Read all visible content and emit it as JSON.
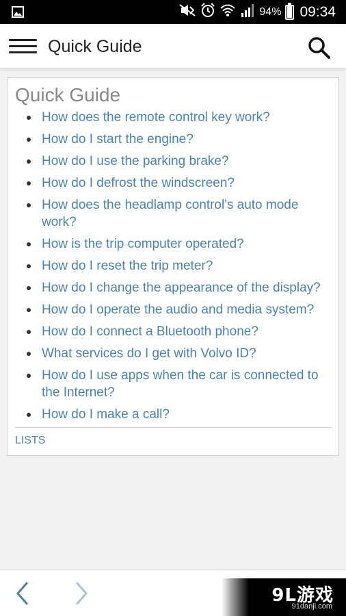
{
  "status_bar": {
    "battery_percent": "94%",
    "battery_level": 0.94,
    "time": "09:34",
    "icons": [
      "image-icon",
      "mute-icon",
      "alarm-icon",
      "wifi-icon",
      "signal-icon",
      "battery-icon"
    ]
  },
  "app_bar": {
    "title": "Quick Guide"
  },
  "card": {
    "title": "Quick Guide",
    "items": [
      "How does the remote control key work?",
      "How do I start the engine?",
      "How do I use the parking brake?",
      "How do I defrost the windscreen?",
      "How does the headlamp control's auto mode work?",
      "How is the trip computer operated?",
      "How do I reset the trip meter?",
      "How do I change the appearance of the display?",
      "How do I operate the audio and media system?",
      "How do I connect a Bluetooth phone?",
      "What services do I get with Volvo ID?",
      "How do I use apps when the car is connected to the Internet?",
      "How do I make a call?"
    ],
    "footer_link": "LISTS"
  },
  "watermark": {
    "logo": "9L游戏",
    "url": "91danji.com"
  },
  "colors": {
    "link": "#4a82b0",
    "title_gray": "#888888",
    "status_bar_bg": "#000000"
  }
}
